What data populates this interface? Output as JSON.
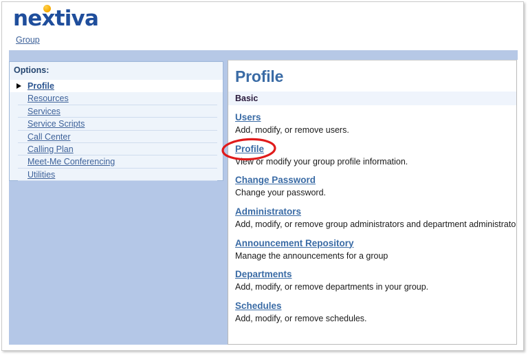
{
  "brand": {
    "logo_text": "nextiva",
    "logo_dot_color": "#f5a800",
    "logo_color": "#1f4e9c",
    "context_link": "Group"
  },
  "sidebar": {
    "title": "Options:",
    "items": [
      {
        "label": "Profile",
        "active": true
      },
      {
        "label": "Resources",
        "active": false
      },
      {
        "label": "Services",
        "active": false
      },
      {
        "label": "Service Scripts",
        "active": false
      },
      {
        "label": "Call Center",
        "active": false
      },
      {
        "label": "Calling Plan",
        "active": false
      },
      {
        "label": "Meet-Me Conferencing",
        "active": false
      },
      {
        "label": "Utilities",
        "active": false
      }
    ]
  },
  "main": {
    "title": "Profile",
    "section_label": "Basic",
    "entries": [
      {
        "link": "Users",
        "desc": "Add, modify, or remove users."
      },
      {
        "link": "Profile",
        "desc": "View or modify your group profile information."
      },
      {
        "link": "Change Password",
        "desc": "Change your password."
      },
      {
        "link": "Administrators",
        "desc": "Add, modify, or remove group administrators and department administrators."
      },
      {
        "link": "Announcement Repository",
        "desc": "Manage the announcements for a group"
      },
      {
        "link": "Departments",
        "desc": "Add, modify, or remove departments in your group."
      },
      {
        "link": "Schedules",
        "desc": "Add, modify, or remove schedules."
      }
    ]
  },
  "annotation": {
    "shape": "ellipse",
    "color": "#e01b1b",
    "target": "Profile"
  },
  "colors": {
    "link": "#3a6ba5",
    "sidebar_blue": "#b4c7e7",
    "options_bg": "#eef4fb",
    "band_blue": "#b6c8e6",
    "section_band": "#eff4fc"
  }
}
